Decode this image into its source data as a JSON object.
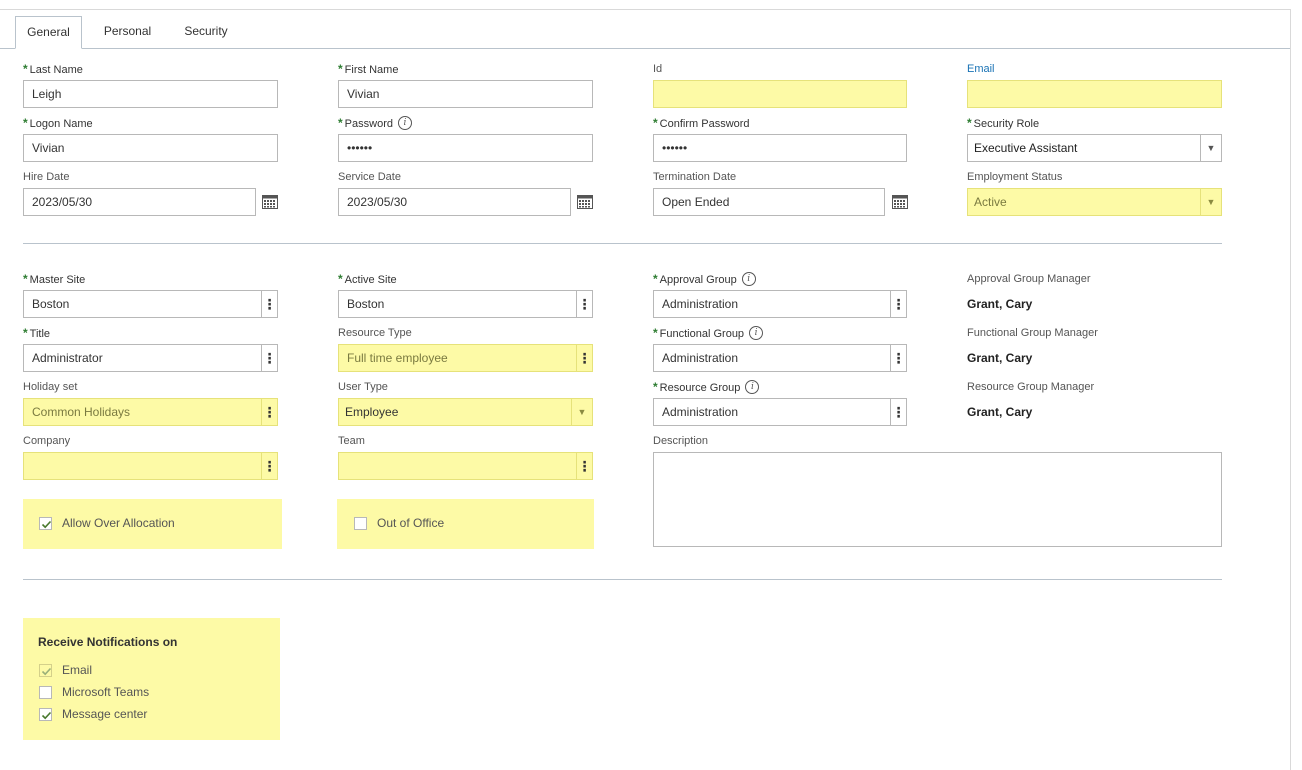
{
  "tabs": {
    "general": "General",
    "personal": "Personal",
    "security": "Security"
  },
  "fields": {
    "last_name": {
      "label": "Last Name",
      "value": "Leigh"
    },
    "first_name": {
      "label": "First Name",
      "value": "Vivian"
    },
    "id": {
      "label": "Id",
      "value": ""
    },
    "email": {
      "label": "Email",
      "value": ""
    },
    "logon_name": {
      "label": "Logon Name",
      "value": "Vivian"
    },
    "password": {
      "label": "Password",
      "value": "••••••"
    },
    "confirm_password": {
      "label": "Confirm Password",
      "value": "••••••"
    },
    "security_role": {
      "label": "Security Role",
      "value": "Executive Assistant"
    },
    "hire_date": {
      "label": "Hire Date",
      "value": "2023/05/30"
    },
    "service_date": {
      "label": "Service Date",
      "value": "2023/05/30"
    },
    "termination_date": {
      "label": "Termination Date",
      "value": "Open Ended"
    },
    "employment_status": {
      "label": "Employment Status",
      "value": "Active"
    },
    "master_site": {
      "label": "Master Site",
      "value": "Boston"
    },
    "active_site": {
      "label": "Active Site",
      "value": "Boston"
    },
    "approval_group": {
      "label": "Approval Group",
      "value": "Administration"
    },
    "approval_group_manager": {
      "label": "Approval Group Manager",
      "value": "Grant, Cary"
    },
    "title": {
      "label": "Title",
      "value": "Administrator"
    },
    "resource_type": {
      "label": "Resource Type",
      "value": "Full time employee"
    },
    "functional_group": {
      "label": "Functional Group",
      "value": "Administration"
    },
    "functional_group_manager": {
      "label": "Functional Group Manager",
      "value": "Grant, Cary"
    },
    "holiday_set": {
      "label": "Holiday set",
      "value": "Common Holidays"
    },
    "user_type": {
      "label": "User Type",
      "value": "Employee"
    },
    "resource_group": {
      "label": "Resource Group",
      "value": "Administration"
    },
    "resource_group_manager": {
      "label": "Resource Group Manager",
      "value": "Grant, Cary"
    },
    "company": {
      "label": "Company",
      "value": ""
    },
    "team": {
      "label": "Team",
      "value": ""
    },
    "description": {
      "label": "Description",
      "value": ""
    }
  },
  "checkboxes": {
    "allow_over_allocation": {
      "label": "Allow Over Allocation",
      "checked": true
    },
    "out_of_office": {
      "label": "Out of Office",
      "checked": false
    }
  },
  "notifications": {
    "title": "Receive Notifications on",
    "email": {
      "label": "Email",
      "checked": true
    },
    "teams": {
      "label": "Microsoft Teams",
      "checked": false
    },
    "message_center": {
      "label": "Message center",
      "checked": true
    }
  },
  "colors": {
    "highlight": "#fdfaa6",
    "required_asterisk": "#2e7d32",
    "link": "#1a73b5",
    "divider": "#b9c3cc"
  }
}
